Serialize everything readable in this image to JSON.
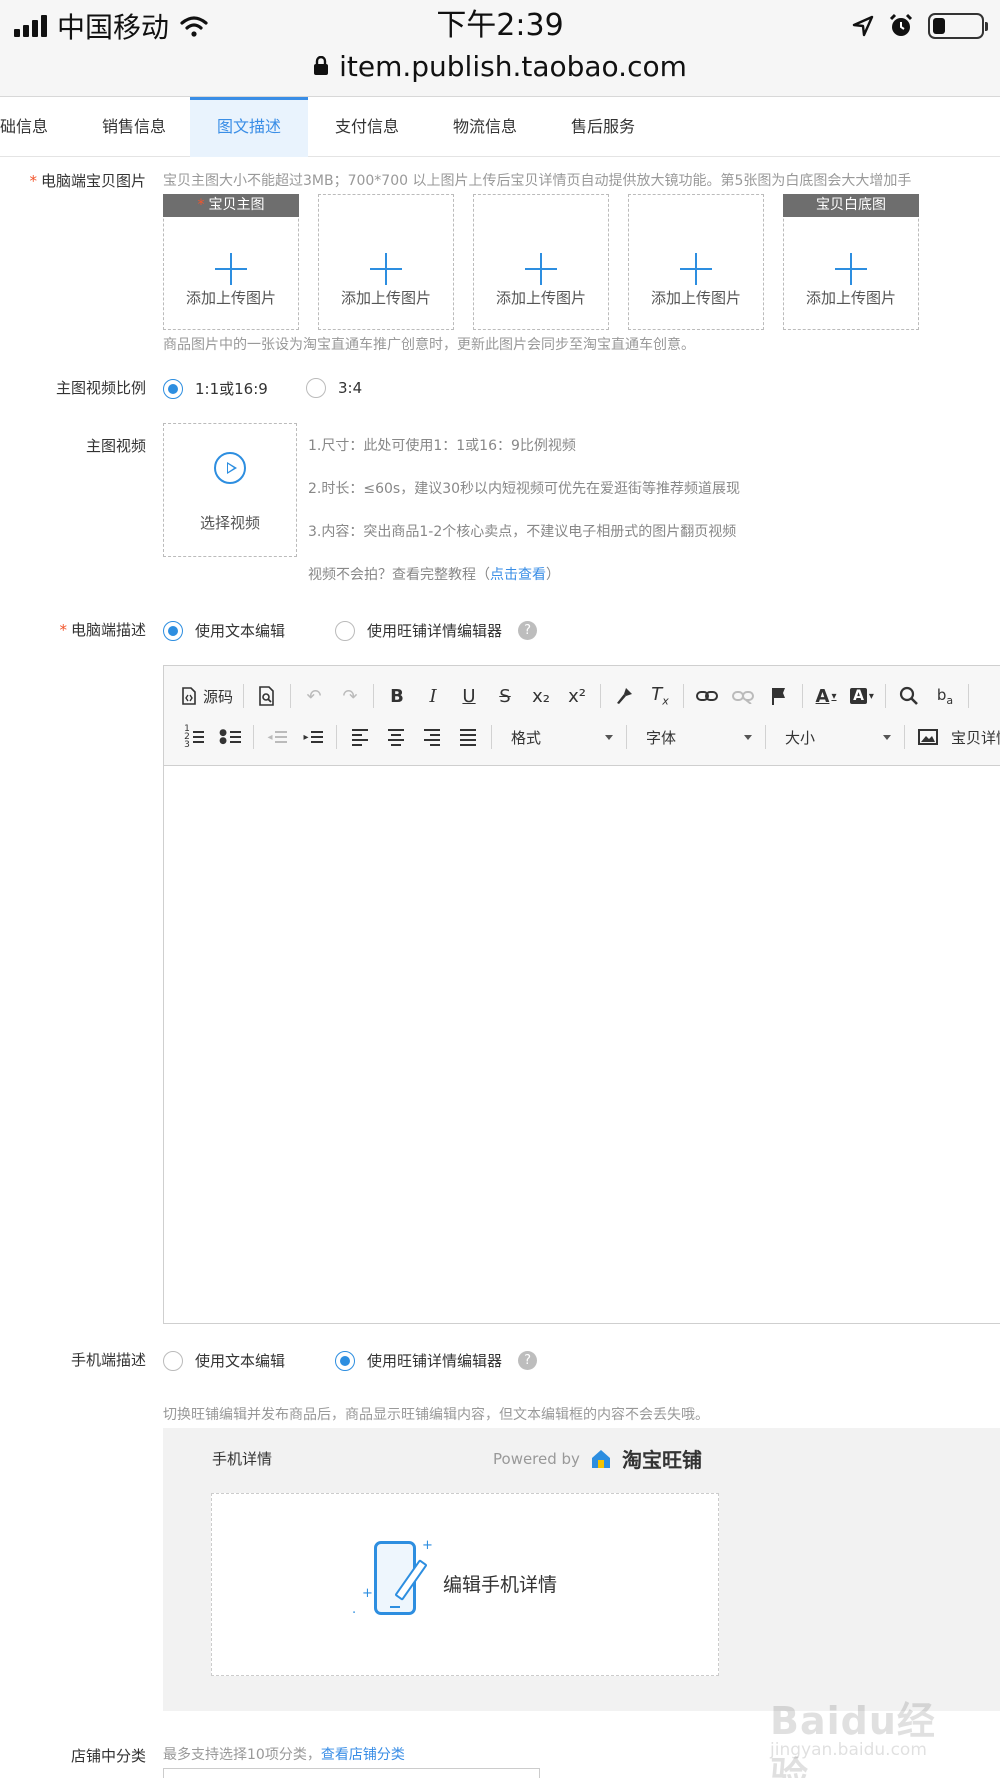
{
  "status_bar": {
    "carrier": "中国移动",
    "time": "下午2:39"
  },
  "browser": {
    "url": "item.publish.taobao.com"
  },
  "tabs": [
    {
      "label": "础信息"
    },
    {
      "label": "销售信息"
    },
    {
      "label": "图文描述",
      "active": true
    },
    {
      "label": "支付信息"
    },
    {
      "label": "物流信息"
    },
    {
      "label": "售后服务"
    }
  ],
  "pc_images": {
    "label": "电脑端宝贝图片",
    "hint": "宝贝主图大小不能超过3MB；700*700 以上图片上传后宝贝详情页自动提供放大镜功能。第5张图为白底图会大大增加手",
    "main_tag": "宝贝主图",
    "white_tag": "宝贝白底图",
    "upload_text": "添加上传图片",
    "footer_hint": "商品图片中的一张设为淘宝直通车推广创意时，更新此图片会同步至淘宝直通车创意。"
  },
  "video_ratio": {
    "label": "主图视频比例",
    "options": [
      "1:1或16:9",
      "3:4"
    ],
    "selected": "1:1或16:9"
  },
  "main_video": {
    "label": "主图视频",
    "button": "选择视频",
    "notes": [
      "1.尺寸：此处可使用1：1或16：9比例视频",
      "2.时长：≤60s，建议30秒以内短视频可优先在爱逛街等推荐频道展现",
      "3.内容：突出商品1-2个核心卖点，不建议电子相册式的图片翻页视频"
    ],
    "tutorial_prefix": "视频不会拍？查看完整教程（",
    "tutorial_link": "点击查看",
    "tutorial_suffix": "）"
  },
  "pc_desc": {
    "label": "电脑端描述",
    "options": [
      "使用文本编辑",
      "使用旺铺详情编辑器"
    ],
    "selected": "使用文本编辑"
  },
  "editor": {
    "source_label": "源码",
    "format_label": "格式",
    "font_label": "字体",
    "size_label": "大小",
    "detail_label": "宝贝详情"
  },
  "mobile_desc": {
    "label": "手机端描述",
    "options": [
      "使用文本编辑",
      "使用旺铺详情编辑器"
    ],
    "selected": "使用旺铺详情编辑器",
    "hint": "切换旺铺编辑并发布商品后，商品显示旺铺编辑内容，但文本编辑框的内容不会丢失哦。",
    "panel_title": "手机详情",
    "powered_by": "Powered by",
    "brand": "淘宝旺铺",
    "edit_text": "编辑手机详情"
  },
  "store_category": {
    "label": "店铺中分类",
    "hint": "最多支持选择10项分类，",
    "link": "查看店铺分类"
  },
  "watermark": {
    "main": "Baidu经验",
    "sub": "jingyan.baidu.com"
  },
  "colors": {
    "accent": "#2d8ee0",
    "required": "#f2552c",
    "active_tab_bg": "#e9f3fd"
  }
}
